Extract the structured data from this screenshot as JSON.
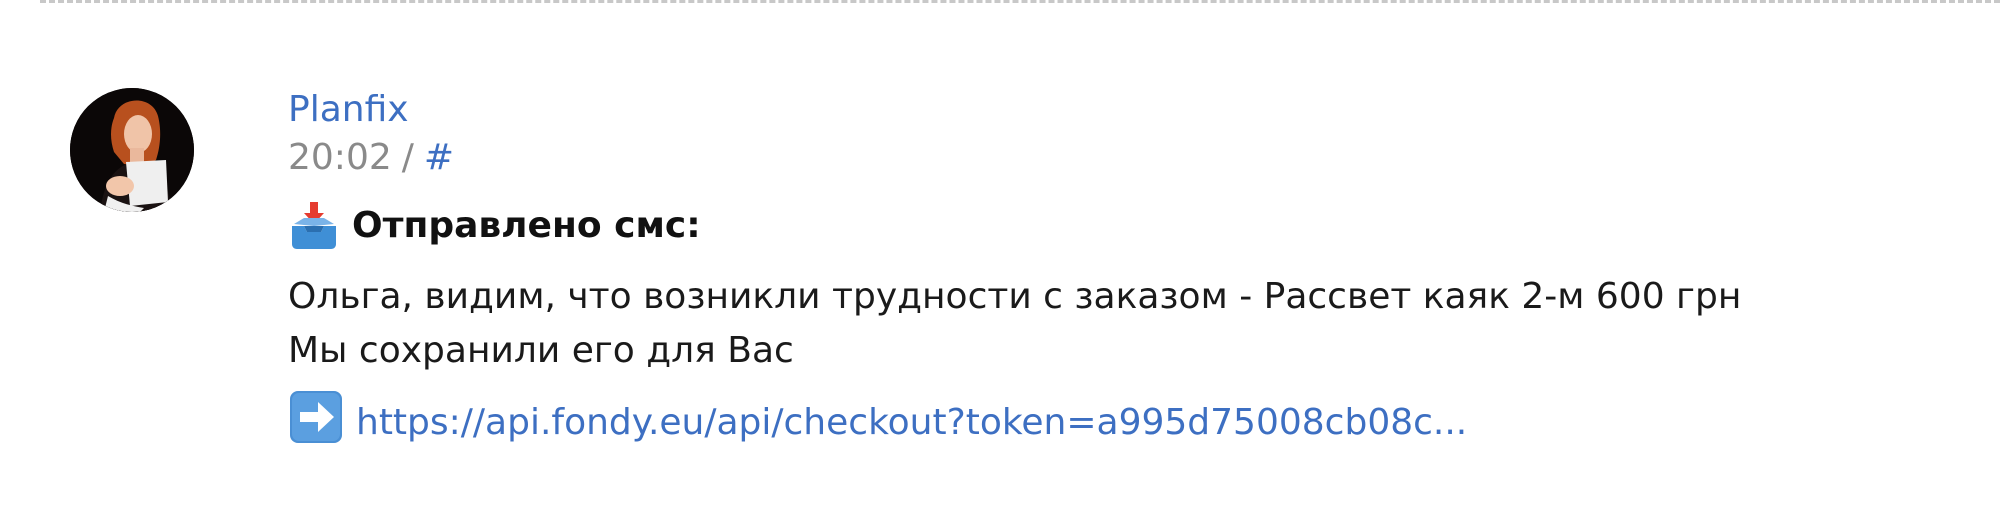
{
  "message": {
    "author": "Planfix",
    "time": "20:02",
    "separator": "/",
    "anchor": "#",
    "sms_title_icon": "outbox-tray-icon",
    "sms_title": "Отправлено смс:",
    "lines": [
      "Ольга, видим, что возникли трудности с заказом - Рассвет каяк 2-м 600 грн",
      "Мы сохранили его для Вас"
    ],
    "link_icon": "right-arrow-icon",
    "link_text": "https://api.fondy.eu/api/checkout?token=a995d75008cb08c..."
  },
  "colors": {
    "link": "#3d6fc2",
    "muted": "#8a8a8a",
    "text": "#1a1a1a",
    "divider": "#c8c8c8"
  }
}
